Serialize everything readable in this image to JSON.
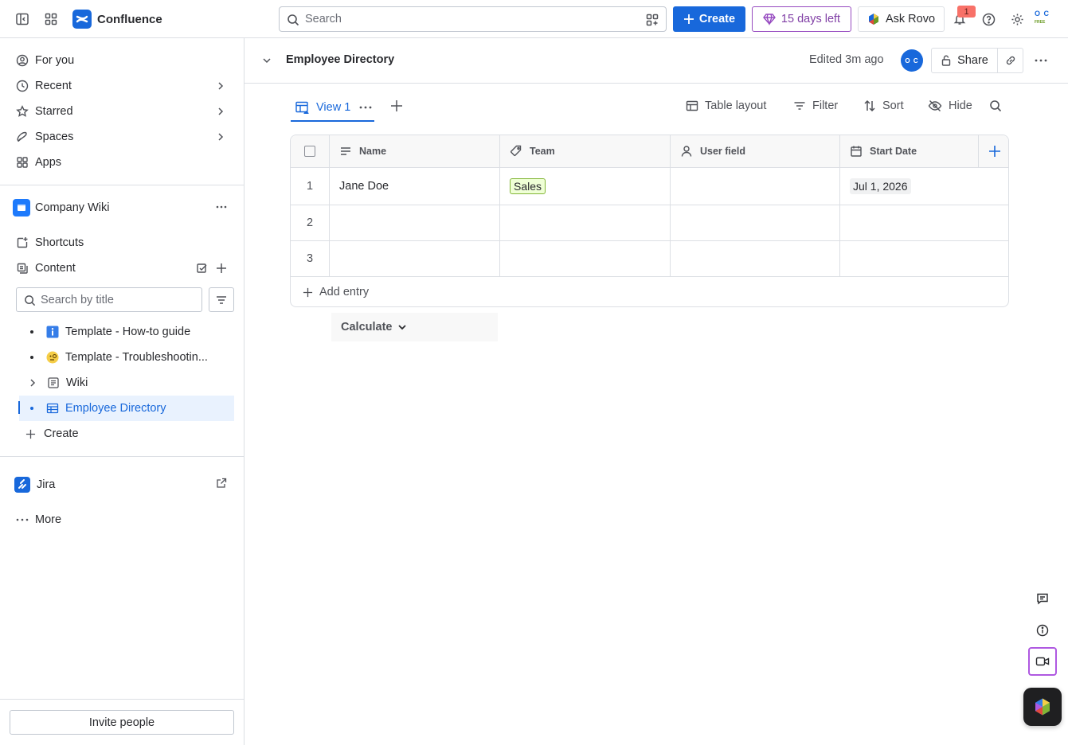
{
  "app": {
    "name": "Confluence",
    "search_placeholder": "Search",
    "create_label": "Create",
    "trial_label": "15 days left",
    "rovo_label": "Ask Rovo",
    "notification_count": "1",
    "user_initials": "O C",
    "user_sub": "FREE"
  },
  "sidebar": {
    "nav": [
      {
        "label": "For you",
        "icon": "user-circle-icon"
      },
      {
        "label": "Recent",
        "icon": "clock-icon"
      },
      {
        "label": "Starred",
        "icon": "star-icon"
      },
      {
        "label": "Spaces",
        "icon": "spaces-icon"
      },
      {
        "label": "Apps",
        "icon": "apps-icon"
      }
    ],
    "space_name": "Company Wiki",
    "shortcuts_label": "Shortcuts",
    "content_label": "Content",
    "search_placeholder": "Search by title",
    "tree": [
      {
        "label": "Template - How-to guide",
        "icon": "info-icon"
      },
      {
        "label": "Template - Troubleshootin...",
        "icon": "emoji-face-icon"
      },
      {
        "label": "Wiki",
        "icon": "page-icon"
      },
      {
        "label": "Employee Directory",
        "icon": "database-icon"
      }
    ],
    "create_label": "Create",
    "jira_label": "Jira",
    "more_label": "More",
    "invite_label": "Invite people"
  },
  "page": {
    "title": "Employee Directory",
    "edited": "Edited 3m ago",
    "avatar_initials": "O C",
    "share_label": "Share"
  },
  "view": {
    "tab_label": "View 1",
    "toolbar": {
      "layout": "Table layout",
      "filter": "Filter",
      "sort": "Sort",
      "hide": "Hide"
    }
  },
  "table": {
    "columns": [
      {
        "label": "Name",
        "icon": "text-icon"
      },
      {
        "label": "Team",
        "icon": "tag-icon"
      },
      {
        "label": "User field",
        "icon": "person-icon"
      },
      {
        "label": "Start Date",
        "icon": "calendar-icon"
      }
    ],
    "rows": [
      {
        "num": "1",
        "name": "Jane Doe",
        "team": "Sales",
        "user": "",
        "start": "Jul 1, 2026"
      },
      {
        "num": "2",
        "name": "",
        "team": "",
        "user": "",
        "start": ""
      },
      {
        "num": "3",
        "name": "",
        "team": "",
        "user": "",
        "start": ""
      }
    ],
    "add_entry_label": "Add entry",
    "calculate_label": "Calculate"
  }
}
